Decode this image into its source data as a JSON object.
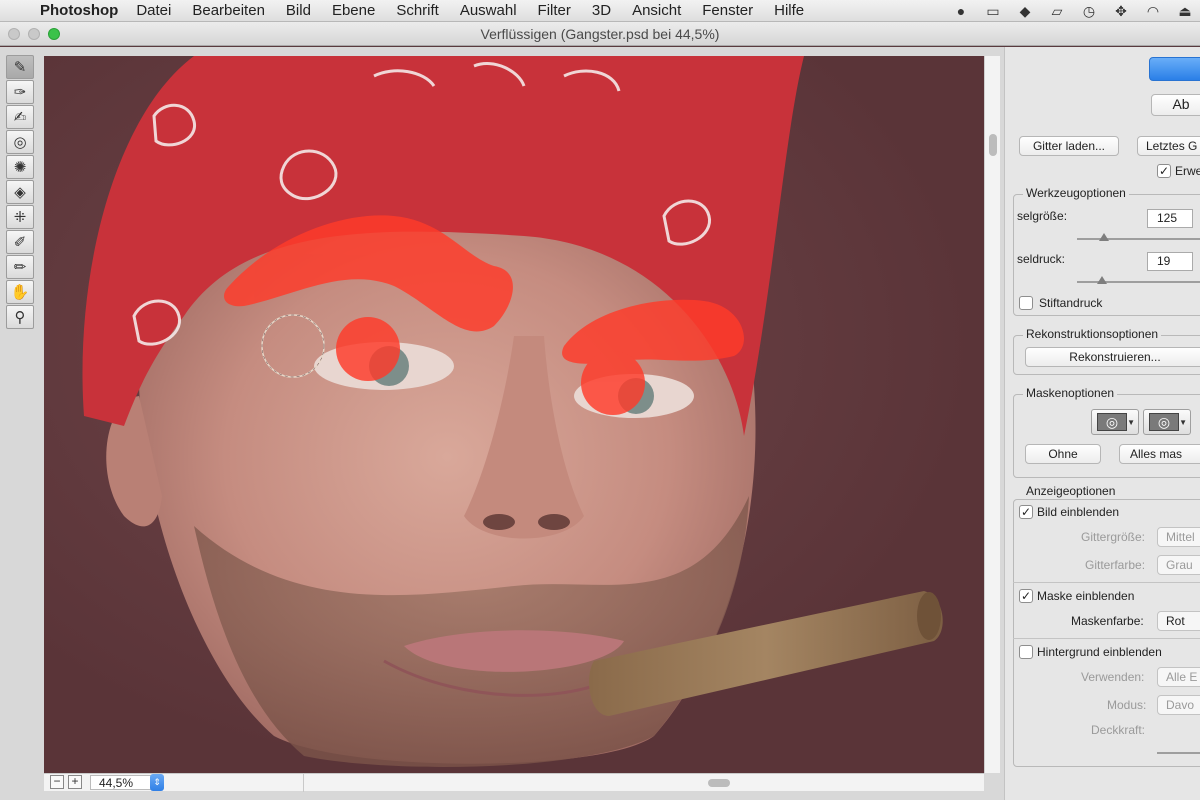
{
  "menubar": {
    "app_name": "Photoshop",
    "menus": [
      "Datei",
      "Bearbeiten",
      "Bild",
      "Ebene",
      "Schrift",
      "Auswahl",
      "Filter",
      "3D",
      "Ansicht",
      "Fenster",
      "Hilfe"
    ],
    "status_icons": [
      "spy-hat-icon",
      "battery-icon",
      "dropbox-icon",
      "airplay-icon",
      "time-machine-icon",
      "move-icon",
      "wifi-icon",
      "eject-icon"
    ]
  },
  "window": {
    "title": "Verflüssigen (Gangster.psd bei 44,5%)"
  },
  "tools": [
    "forward-warp-icon",
    "reconstruct-icon",
    "smooth-icon",
    "twirl-icon",
    "pucker-icon",
    "bloat-icon",
    "push-left-icon",
    "freeze-mask-icon",
    "thaw-mask-icon",
    "hand-icon",
    "zoom-icon"
  ],
  "bottombar": {
    "zoom_minus": "−",
    "zoom_plus": "+",
    "zoom_value": "44,5%"
  },
  "panel": {
    "ok_label": "",
    "cancel_label": "Ab",
    "load_mesh_label": "Gitter laden...",
    "last_mesh_label": "Letztes G",
    "advanced_label": "Erwe",
    "tool_options": {
      "title": "Werkzeugoptionen",
      "brush_size_label": "selgröße:",
      "brush_size_value": "125",
      "brush_size_level": 0.3,
      "brush_pressure_label": "seldruck:",
      "brush_pressure_value": "19",
      "brush_pressure_level": 0.19,
      "stylus_label": "Stiftandruck"
    },
    "reconstruct_options": {
      "title": "Rekonstruktionsoptionen",
      "reconstruct_label": "Rekonstruieren..."
    },
    "mask_options": {
      "title": "Maskenoptionen",
      "none_label": "Ohne",
      "mask_all_label": "Alles mas"
    },
    "view_options": {
      "title": "Anzeigeoptionen",
      "show_image_label": "Bild einblenden",
      "mesh_size_label": "Gittergröße:",
      "mesh_size_value": "Mittel",
      "mesh_color_label": "Gitterfarbe:",
      "mesh_color_value": "Grau",
      "show_mask_label": "Maske einblenden",
      "mask_color_label": "Maskenfarbe:",
      "mask_color_value": "Rot",
      "show_backdrop_label": "Hintergrund einblenden",
      "use_label": "Verwenden:",
      "use_value": "Alle E",
      "mode_label": "Modus:",
      "mode_value": "Davo",
      "opacity_label": "Deckkraft:"
    }
  },
  "colors": {
    "accent": "#2a7fe7",
    "mask_red": "#ff3b2a",
    "bandana_red": "#c8323a"
  }
}
